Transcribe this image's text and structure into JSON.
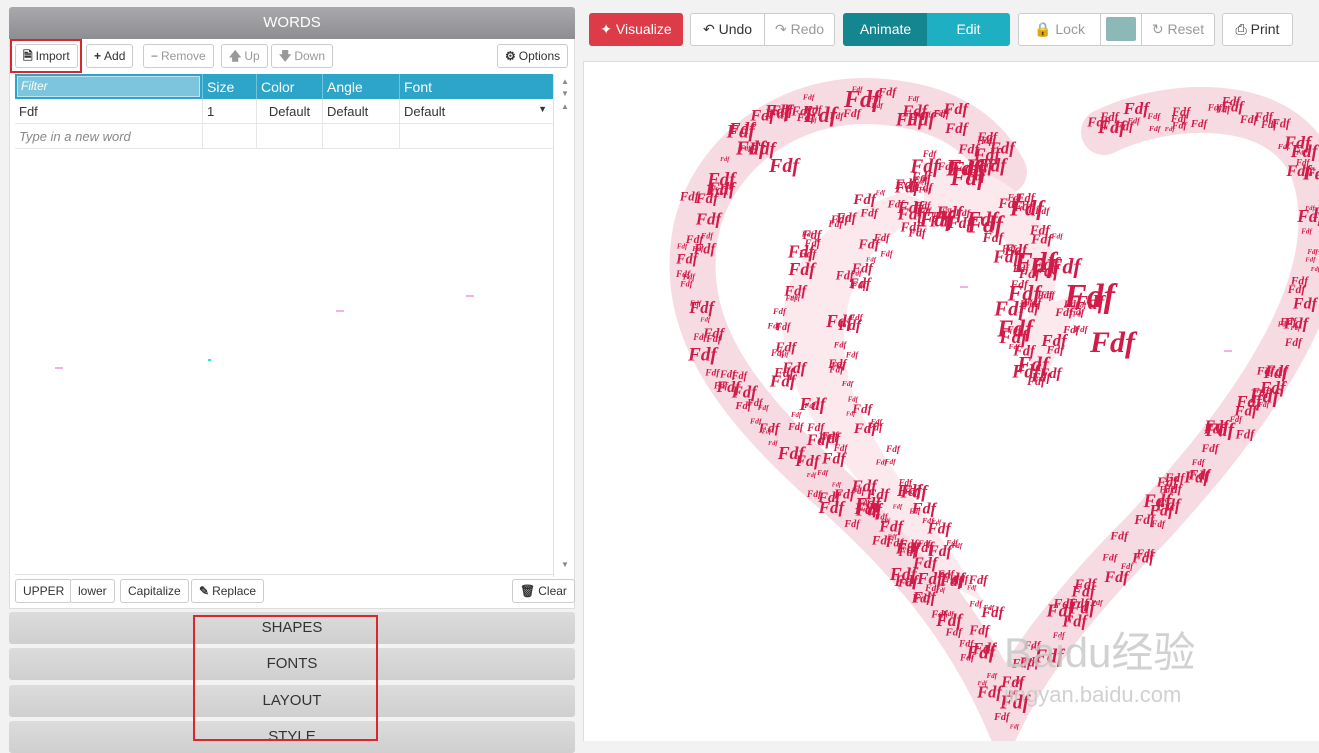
{
  "words_panel": {
    "title": "WORDS",
    "toolbar": {
      "import": "Import",
      "add": "Add",
      "remove": "Remove",
      "up": "Up",
      "down": "Down",
      "options": "Options"
    },
    "columns": [
      "Size",
      "Color",
      "Angle",
      "Font"
    ],
    "filter_placeholder": "Filter",
    "rows": [
      {
        "word": "Fdf",
        "size": "1",
        "color": "Default",
        "angle": "Default",
        "font": "Default"
      }
    ],
    "new_word_placeholder": "Type in a new word",
    "case_buttons": {
      "upper": "UPPER",
      "lower": "lower",
      "capitalize": "Capitalize",
      "replace": "Replace",
      "clear": "Clear"
    }
  },
  "accordion": [
    "SHAPES",
    "FONTS",
    "LAYOUT",
    "STYLE"
  ],
  "top_toolbar": {
    "visualize": "Visualize",
    "undo": "Undo",
    "redo": "Redo",
    "animate": "Animate",
    "edit": "Edit",
    "lock": "Lock",
    "reset": "Reset",
    "print": "Print"
  },
  "colors": {
    "visualize_bg": "#dd3b48",
    "animate_bg": "#14868f",
    "edit_bg": "#1eafc2",
    "swatch": "#8db8b8",
    "word_red": "#d21b48",
    "highlight": "#d9272e"
  },
  "canvas": {
    "cloud_word": "Fdf",
    "watermark": "Baidu经验",
    "watermark_url": "jingyan.baidu.com"
  }
}
